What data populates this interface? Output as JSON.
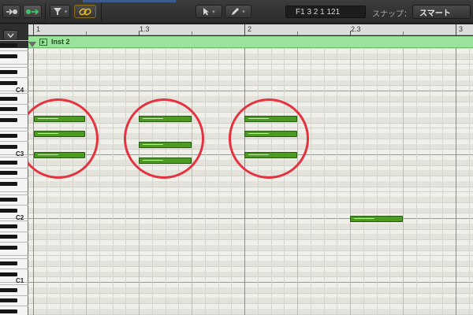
{
  "toolbar": {
    "position": "F1   3 2 1 121",
    "snap_label": "スナップ：",
    "snap_value": "スマート"
  },
  "ruler": {
    "marks": [
      "1",
      "1.3",
      "2",
      "2.3",
      "3"
    ]
  },
  "region": {
    "name": "Inst 2"
  },
  "keyboard": {
    "labels": [
      "C4",
      "C3",
      "C2",
      "C1"
    ]
  },
  "colors": {
    "note_fill": "#4c9a21",
    "region": "#9be39b",
    "annotation_circle": "#e6323f"
  }
}
